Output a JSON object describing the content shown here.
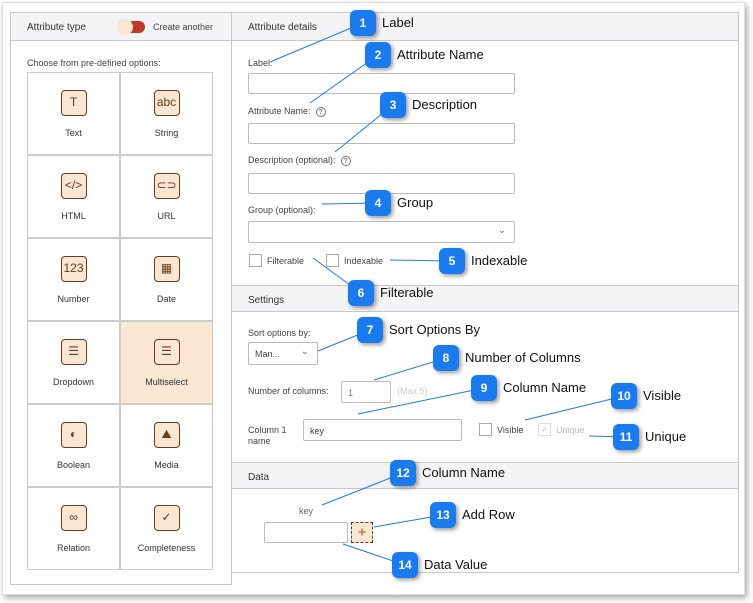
{
  "left": {
    "title": "Attribute type",
    "toggle_label": "Create another",
    "toggle_on": true,
    "choose_label": "Choose from pre-defined options:",
    "tiles": [
      {
        "label": "Text",
        "icon": "T"
      },
      {
        "label": "String",
        "icon": "abc"
      },
      {
        "label": "HTML",
        "icon": "</>"
      },
      {
        "label": "URL",
        "icon": "⊂⊃"
      },
      {
        "label": "Number",
        "icon": "123"
      },
      {
        "label": "Date",
        "icon": "▦"
      },
      {
        "label": "Dropdown",
        "icon": "☰"
      },
      {
        "label": "Multiselect",
        "icon": "☰",
        "selected": true
      },
      {
        "label": "Boolean",
        "icon": "◐"
      },
      {
        "label": "Media",
        "icon": "⛰"
      },
      {
        "label": "Relation",
        "icon": "∞"
      },
      {
        "label": "Completeness",
        "icon": "✓"
      }
    ]
  },
  "details": {
    "title": "Attribute details",
    "label_label": "Label:",
    "name_label": "Attribute Name:",
    "desc_label": "Description (optional):",
    "group_label": "Group (optional):",
    "filterable": "Filterable",
    "indexable": "Indexable",
    "help": "?"
  },
  "settings": {
    "title": "Settings",
    "sort_label": "Sort options by:",
    "sort_value": "Man...",
    "numcols_label": "Number of columns:",
    "numcols_value": "1",
    "max_note": "(Max 5)",
    "col1_label": "Column 1 name",
    "col1_value": "key",
    "visible": "Visible",
    "unique": "Unique"
  },
  "data": {
    "title": "Data",
    "col_header": "key",
    "add_icon": "+"
  },
  "callouts": [
    {
      "n": "1",
      "t": "Label"
    },
    {
      "n": "2",
      "t": "Attribute Name"
    },
    {
      "n": "3",
      "t": "Description"
    },
    {
      "n": "4",
      "t": "Group"
    },
    {
      "n": "5",
      "t": "Indexable"
    },
    {
      "n": "6",
      "t": "Filterable"
    },
    {
      "n": "7",
      "t": "Sort Options By"
    },
    {
      "n": "8",
      "t": "Number of Columns"
    },
    {
      "n": "9",
      "t": "Column Name"
    },
    {
      "n": "10",
      "t": "Visible"
    },
    {
      "n": "11",
      "t": "Unique"
    },
    {
      "n": "12",
      "t": "Column Name"
    },
    {
      "n": "13",
      "t": "Add Row"
    },
    {
      "n": "14",
      "t": "Data Value"
    }
  ],
  "colors": {
    "accent": "#1a7bef",
    "tile_bg": "#f9e6d3",
    "toggle": "#c0392b"
  }
}
